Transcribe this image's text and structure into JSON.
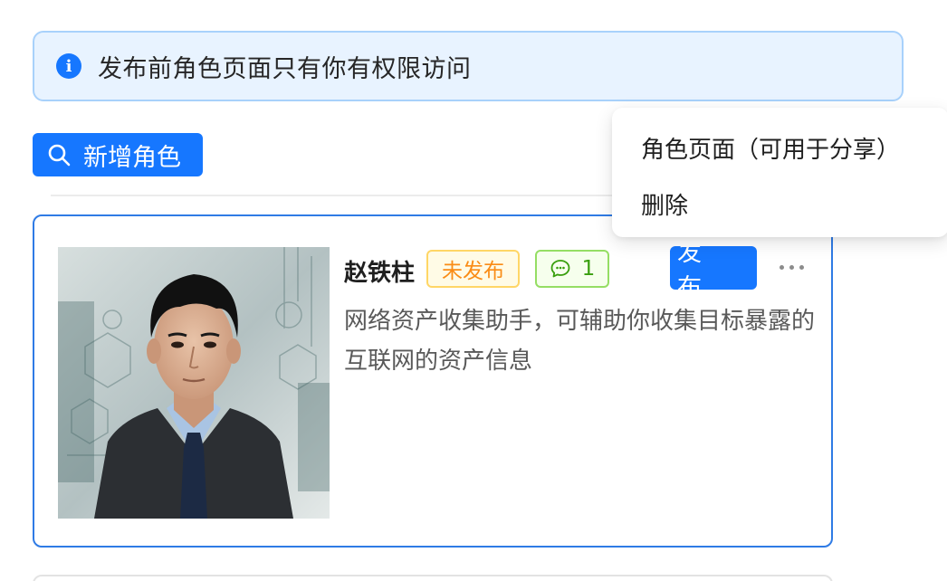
{
  "notice": {
    "icon": "info-icon",
    "text": "发布前角色页面只有你有权限访问"
  },
  "toolbar": {
    "add_role_label": "新增角色",
    "add_role_icon": "search-icon"
  },
  "role_card": {
    "name": "赵铁柱",
    "status_badge": "未发布",
    "chat_count": "1",
    "chat_icon": "chat-bubble-icon",
    "publish_label": "发 布",
    "more_icon": "more-ellipsis-icon",
    "description": "网络资产收集助手，可辅助你收集目标暴露的互联网的资产信息"
  },
  "dropdown": {
    "items": [
      {
        "label": "角色页面（可用于分享）"
      },
      {
        "label": "删除"
      }
    ]
  },
  "colors": {
    "primary": "#1677ff",
    "notice_bg": "#e8f3ff",
    "notice_border": "#a8d1fb",
    "draft_text": "#fa8c16",
    "draft_bg": "#fffbe6",
    "chat_text": "#389e0d",
    "chat_bg": "#f6ffed"
  }
}
